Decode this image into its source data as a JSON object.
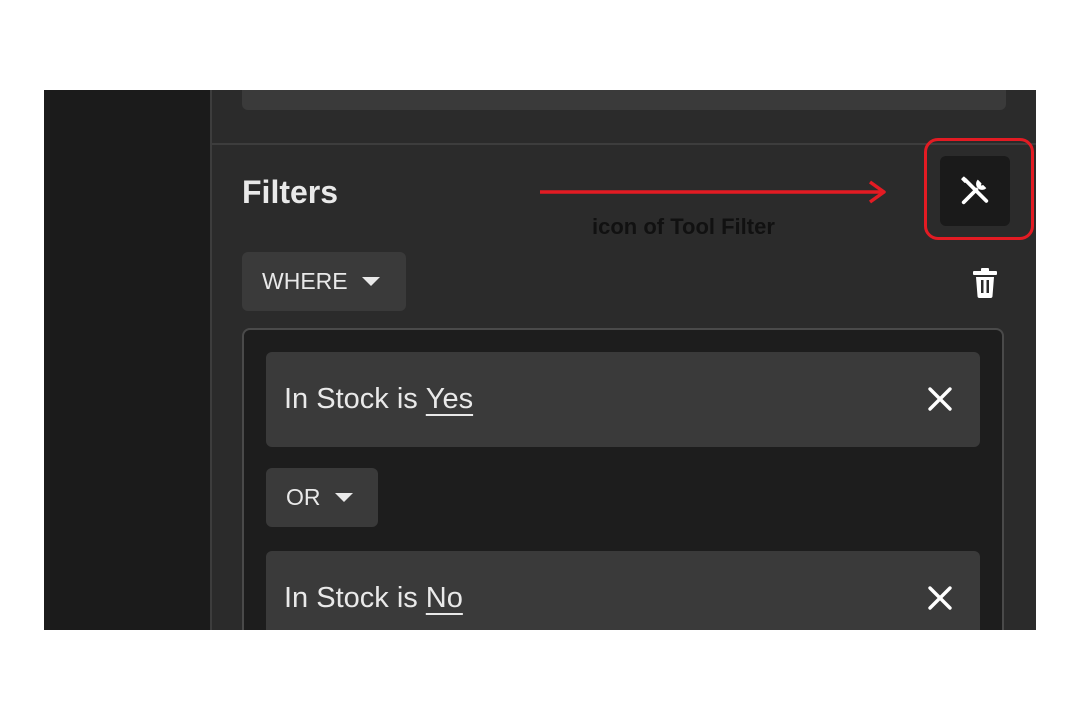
{
  "panel": {
    "title": "Filters",
    "where_label": "WHERE",
    "operator_label": "OR",
    "conditions": [
      {
        "prefix": "In Stock is",
        "value": "Yes"
      },
      {
        "prefix": "In Stock is",
        "value": "No"
      }
    ]
  },
  "annotation": {
    "label": "icon of Tool Filter",
    "color": "#e31b23"
  },
  "icons": {
    "tool": "wrench-screwdriver-icon",
    "delete": "trash-icon",
    "remove": "close-icon",
    "dropdown": "caret-down-icon"
  },
  "colors": {
    "panel_bg": "#2b2b2b",
    "card_bg": "#3a3a3a",
    "group_bg": "#1d1d1d",
    "text": "#e9e9e9"
  }
}
